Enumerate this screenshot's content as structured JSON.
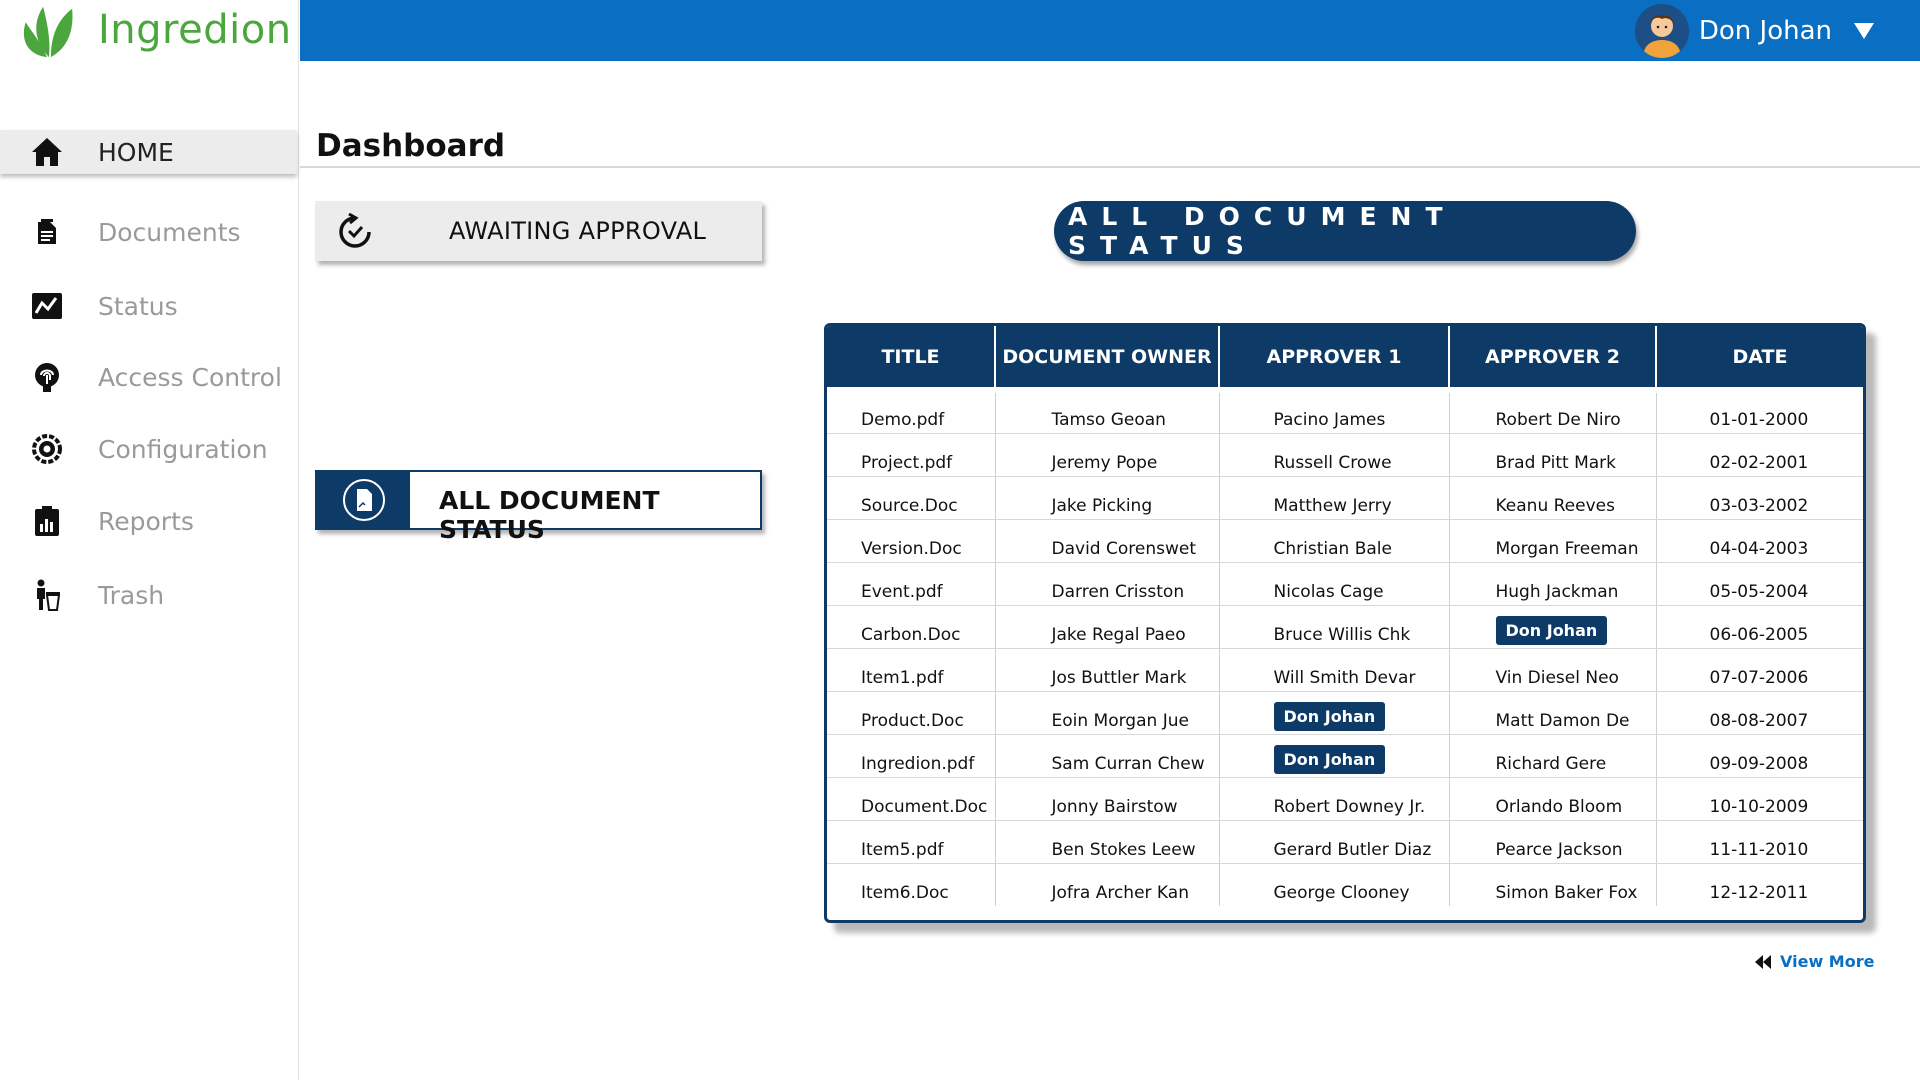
{
  "app": {
    "brand": "Ingredion",
    "brand_color": "#4aa63d",
    "header_color": "#0a6fc2",
    "accent_color": "#0d3a66"
  },
  "user": {
    "name": "Don Johan",
    "avatar_icon": "avatar-icon",
    "menu_icon": "caret-down-icon"
  },
  "sidebar": {
    "items": [
      {
        "label": "HOME",
        "icon": "home-icon",
        "active": true
      },
      {
        "label": "Documents",
        "icon": "document-icon"
      },
      {
        "label": "Status",
        "icon": "chart-icon"
      },
      {
        "label": "Access Control",
        "icon": "fingerprint-icon"
      },
      {
        "label": "Configuration",
        "icon": "gear-icon"
      },
      {
        "label": "Reports",
        "icon": "report-icon"
      },
      {
        "label": "Trash",
        "icon": "trash-icon"
      }
    ]
  },
  "page": {
    "title": "Dashboard"
  },
  "cards": {
    "awaiting": {
      "label": "AWAITING APPROVAL",
      "icon": "refresh-icon"
    },
    "status": {
      "label": "ALL DOCUMENT STATUS",
      "icon": "file-icon"
    }
  },
  "table": {
    "heading": "ALL DOCUMENT STATUS",
    "columns": [
      "TITLE",
      "DOCUMENT OWNER",
      "APPROVER 1",
      "APPROVER 2",
      "DATE"
    ],
    "rows": [
      [
        "Demo.pdf",
        "Tamso Geoan",
        "Pacino James",
        "Robert De Niro",
        "01-01-2000"
      ],
      [
        "Project.pdf",
        "Jeremy Pope",
        "Russell Crowe",
        "Brad Pitt Mark",
        "02-02-2001"
      ],
      [
        "Source.Doc",
        "Jake Picking",
        "Matthew Jerry",
        "Keanu Reeves",
        "03-03-2002"
      ],
      [
        "Version.Doc",
        "David Corenswet",
        "Christian Bale",
        "Morgan Freeman",
        "04-04-2003"
      ],
      [
        "Event.pdf",
        "Darren Crisston",
        "Nicolas Cage",
        "Hugh Jackman",
        "05-05-2004"
      ],
      [
        "Carbon.Doc",
        "Jake Regal Paeo",
        "Bruce Willis Chk",
        "Don Johan",
        "06-06-2005"
      ],
      [
        "Item1.pdf",
        "Jos Buttler Mark",
        "Will Smith Devar",
        "Vin Diesel Neo",
        "07-07-2006"
      ],
      [
        "Product.Doc",
        "Eoin Morgan Jue",
        "Don Johan",
        "Matt Damon De",
        "08-08-2007"
      ],
      [
        "Ingredion.pdf",
        "Sam Curran Chew",
        "Don Johan",
        "Richard Gere",
        "09-09-2008"
      ],
      [
        "Document.Doc",
        "Jonny Bairstow",
        "Robert Downey Jr.",
        "Orlando Bloom",
        "10-10-2009"
      ],
      [
        "Item5.pdf",
        "Ben Stokes Leew",
        "Gerard Butler Diaz",
        "Pearce Jackson",
        "11-11-2010"
      ],
      [
        "Item6.Doc",
        "Jofra Archer Kan",
        "George Clooney",
        "Simon Baker Fox",
        "12-12-2011"
      ]
    ],
    "highlighted_user": "Don Johan"
  },
  "view_more": {
    "label": "View More",
    "icon": "rewind-icon"
  }
}
